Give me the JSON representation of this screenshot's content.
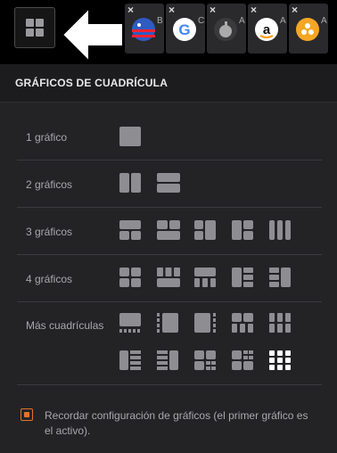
{
  "topbar": {
    "tabs": [
      {
        "title": "B",
        "icon": "us-flag-icon",
        "color": "#3a6bd6"
      },
      {
        "title": "C",
        "icon": "google-icon",
        "color": "#ffffff"
      },
      {
        "title": "A",
        "icon": "apple-icon",
        "color": "#8e8e93"
      },
      {
        "title": "A",
        "icon": "amazon-icon",
        "color": "#ffffff"
      },
      {
        "title": "A",
        "icon": "coins-icon",
        "color": "#f5a623"
      }
    ],
    "close_glyph": "×"
  },
  "panel": {
    "title": "GRÁFICOS DE CUADRÍCULA",
    "rows": [
      {
        "label": "1 gráfico"
      },
      {
        "label": "2 gráficos"
      },
      {
        "label": "3 gráficos"
      },
      {
        "label": "4 gráficos"
      },
      {
        "label": "Más cuadrículas"
      }
    ],
    "remember_label": "Recordar configuración de gráficos (el primer gráfico es el activo).",
    "remember_checked": true
  },
  "colors": {
    "accent": "#e8702a",
    "icon": "#8e8e92",
    "icon_active": "#ffffff"
  }
}
